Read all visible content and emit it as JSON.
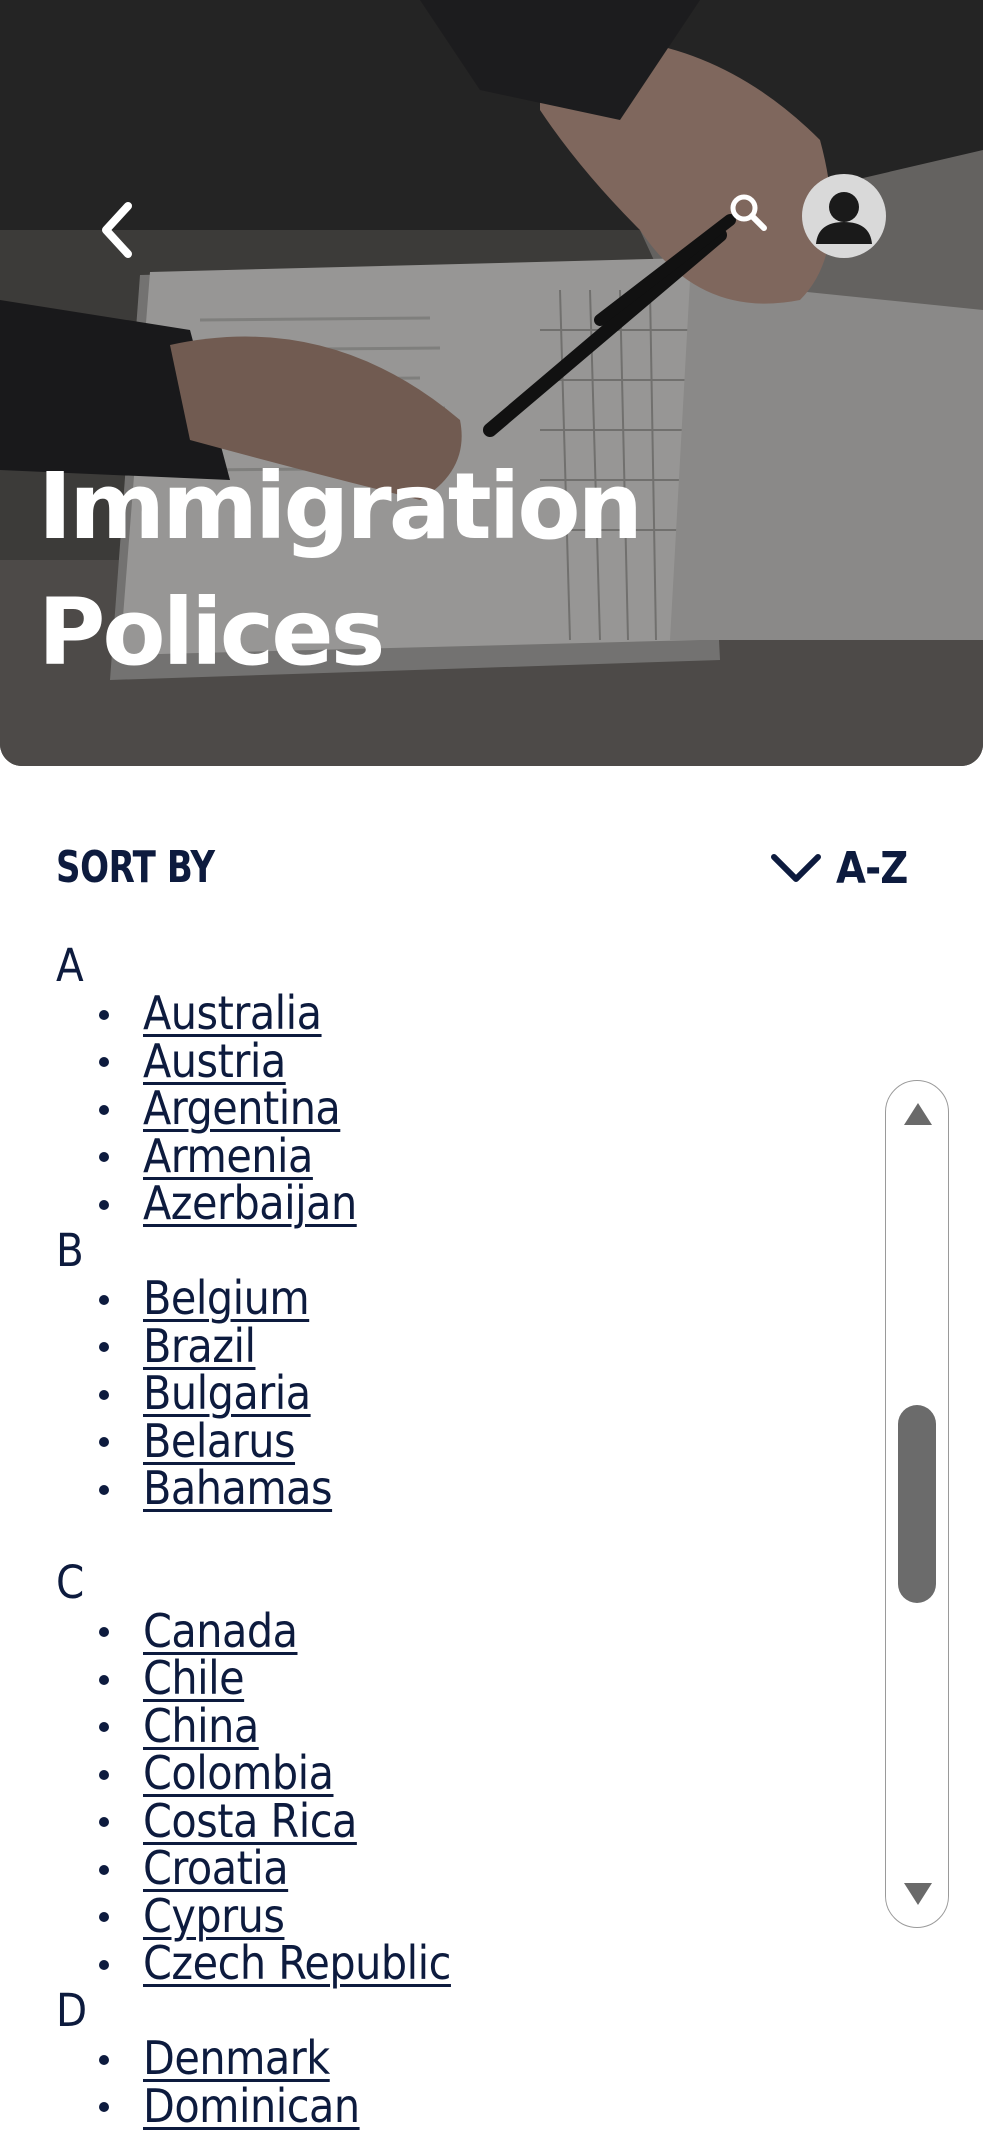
{
  "header": {
    "title_line1": "Immigration",
    "title_line2": "Polices",
    "back_icon": "chevron-left-icon",
    "search_icon": "search-icon",
    "avatar_icon": "user-avatar-icon"
  },
  "sort": {
    "label": "SORT BY",
    "value": "A-Z",
    "icon": "chevron-down-icon"
  },
  "groups": [
    {
      "letter": "A",
      "items": [
        "Australia",
        "Austria",
        "Argentina",
        "Armenia",
        "Azerbaijan"
      ]
    },
    {
      "letter": "B",
      "items": [
        "Belgium",
        "Brazil",
        "Bulgaria",
        "Belarus",
        "Bahamas"
      ]
    },
    {
      "letter": "C",
      "items": [
        "Canada",
        "Chile",
        "China",
        "Colombia",
        "Costa Rica",
        "Croatia",
        "Cyprus",
        "Czech Republic"
      ]
    },
    {
      "letter": "D",
      "items": [
        "Denmark",
        "Dominican"
      ]
    }
  ],
  "colors": {
    "text_navy": "#0d1b3e",
    "scroll_thumb": "#6b6b6b",
    "hero_overlay": "#3b3a39"
  }
}
